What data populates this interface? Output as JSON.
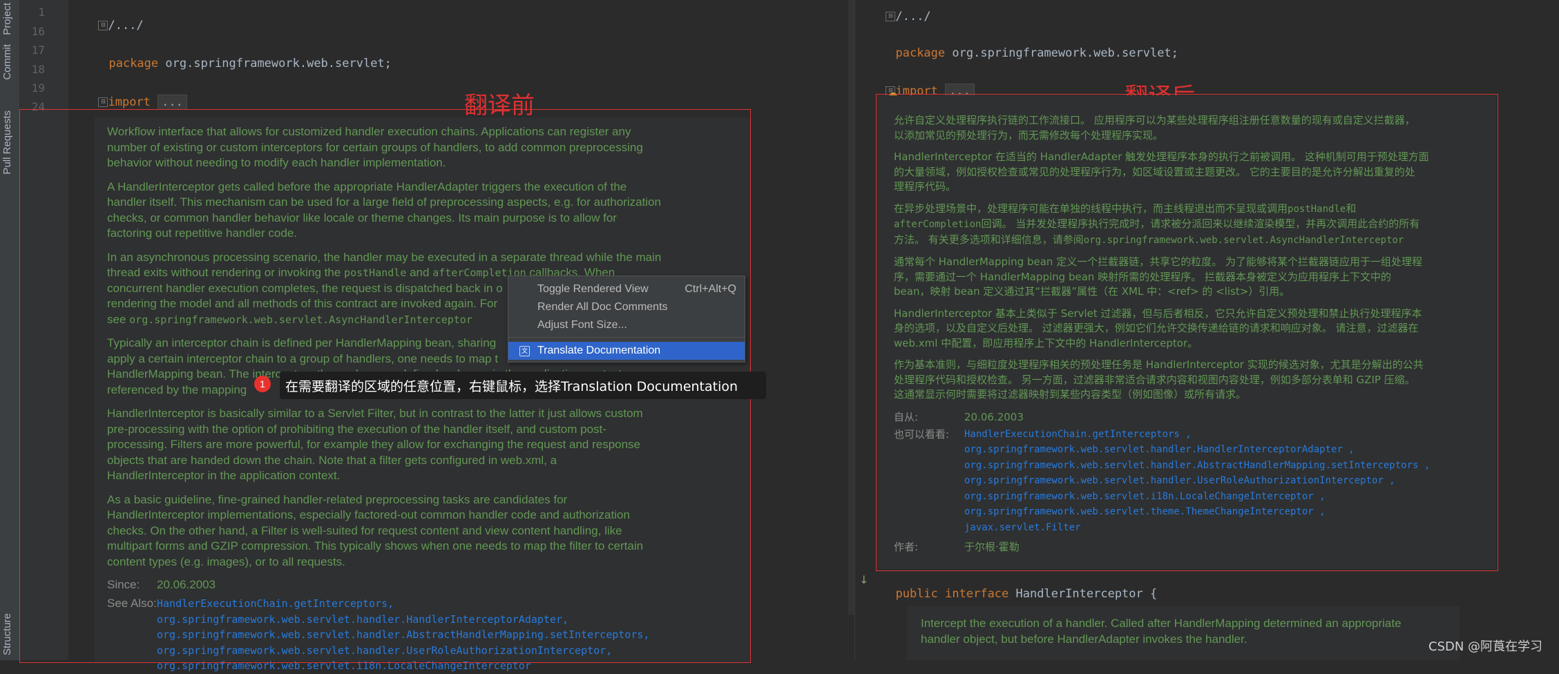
{
  "toolstrip": {
    "tabs": [
      "Project",
      "Commit",
      "Pull Requests",
      "Structure"
    ]
  },
  "left_editor": {
    "line_numbers": [
      "1",
      "16",
      "17",
      "18",
      "19",
      "24"
    ],
    "header_fold": "/.../",
    "package_kw": "package",
    "package_name": "org.springframework.web.servlet;",
    "import_kw": "import",
    "import_fold": "...",
    "title_before": "翻译前",
    "paragraphs": [
      "Workflow interface that allows for customized handler execution chains. Applications can register any\nnumber of existing or custom interceptors for certain groups of handlers, to add common preprocessing\nbehavior without needing to modify each handler implementation.",
      "A HandlerInterceptor gets called before the appropriate HandlerAdapter triggers the execution of the\nhandler itself. This mechanism can be used for a large field of preprocessing aspects, e.g. for authorization\nchecks, or common handler behavior like locale or theme changes. Its main purpose is to allow for\nfactoring out repetitive handler code."
    ],
    "para3_lines": [
      "In an asynchronous processing scenario, the handler may be executed in a separate thread while the main",
      "thread exits without rendering or invoking the",
      "postHandle",
      "and",
      "afterCompletion",
      "callbacks. When",
      "concurrent handler execution completes, the request is dispatched back in o",
      "rendering the model and all methods of this contract are invoked again. For",
      "see",
      "org.springframework.web.servlet.AsyncHandlerInterceptor"
    ],
    "para4_lines": [
      "Typically an interceptor chain is defined per HandlerMapping bean, sharing",
      "apply a certain interceptor chain to a group of handlers, one needs to map t",
      "HandlerMapping bean. The interceptors themselves are defined as beans in the application context,",
      "referenced by the mapping"
    ],
    "paragraphs_tail": [
      "HandlerInterceptor is basically similar to a Servlet Filter, but in contrast to the latter it just allows custom\npre-processing with the option of prohibiting the execution of the handler itself, and custom post-\nprocessing. Filters are more powerful, for example they allow for exchanging the request and response\nobjects that are handed down the chain. Note that a filter gets configured in web.xml, a\nHandlerInterceptor in the application context.",
      "As a basic guideline, fine-grained handler-related preprocessing tasks are candidates for\nHandlerInterceptor implementations, especially factored-out common handler code and authorization\nchecks. On the other hand, a Filter is well-suited for request content and view content handling, like\nmultipart forms and GZIP compression. This typically shows when one needs to map the filter to certain\ncontent types (e.g. images), or to all requests."
    ],
    "since_label": "Since:",
    "since_value": "20.06.2003",
    "see_also_label": "See Also:",
    "see_also": [
      "HandlerExecutionChain.getInterceptors,",
      "org.springframework.web.servlet.handler.HandlerInterceptorAdapter,",
      "org.springframework.web.servlet.handler.AbstractHandlerMapping.setInterceptors,",
      "org.springframework.web.servlet.handler.UserRoleAuthorizationInterceptor,",
      "org.springframework.web.servlet.i18n.LocaleChangeInterceptor"
    ]
  },
  "context_menu": {
    "items": [
      {
        "label": "Toggle Rendered View",
        "shortcut": "Ctrl+Alt+Q"
      },
      {
        "label": "Render All Doc Comments",
        "shortcut": ""
      },
      {
        "label": "Adjust Font Size...",
        "shortcut": ""
      },
      {
        "label": "Translate Documentation",
        "shortcut": ""
      }
    ]
  },
  "tooltip": {
    "badge": "1",
    "text": "在需要翻译的区域的任意位置，右键鼠标，选择Translation Documentation"
  },
  "right_editor": {
    "header_fold": "/.../",
    "package_kw": "package",
    "package_name": "org.springframework.web.servlet;",
    "import_kw": "import",
    "import_fold": "...",
    "title_after": "翻译后",
    "paragraphs": [
      "允许自定义处理程序执行链的工作流接口。 应用程序可以为某些处理程序组注册任意数量的现有或自定义拦截器，\n以添加常见的预处理行为，而无需修改每个处理程序实现。",
      "HandlerInterceptor 在适当的 HandlerAdapter 触发处理程序本身的执行之前被调用。 这种机制可用于预处理方面\n的大量领域，例如授权检查或常见的处理程序行为，如区域设置或主题更改。 它的主要目的是允许分解出重复的处\n理程序代码。"
    ],
    "para3_lines": [
      "在异步处理场景中，处理程序可能在单独的线程中执行，而主线程退出而不呈现或调用",
      "postHandle",
      "和",
      "afterCompletion",
      "回调。 当并发处理程序执行完成时，请求被分派回来以继续渲染模型，并再次调用此合约的所有",
      "方法。 有关更多选项和详细信息，请参阅",
      "org.springframework.web.servlet.AsyncHandlerInterceptor"
    ],
    "paragraphs_tail": [
      "通常每个 HandlerMapping bean 定义一个拦截器链，共享它的粒度。 为了能够将某个拦截器链应用于一组处理程\n序，需要通过一个 HandlerMapping bean 映射所需的处理程序。 拦截器本身被定义为应用程序上下文中的\nbean，映射 bean 定义通过其“拦截器”属性（在 XML 中：<ref> 的 <list>）引用。",
      "HandlerInterceptor 基本上类似于 Servlet 过滤器，但与后者相反，它只允许自定义预处理和禁止执行处理程序本\n身的选项，以及自定义后处理。 过滤器更强大，例如它们允许交换传递给链的请求和响应对象。 请注意，过滤器在\nweb.xml 中配置，即应用程序上下文中的 HandlerInterceptor。",
      "作为基本准则，与细粒度处理程序相关的预处理任务是 HandlerInterceptor 实现的候选对象，尤其是分解出的公共\n处理程序代码和授权检查。 另一方面，过滤器非常适合请求内容和视图内容处理，例如多部分表单和 GZIP 压缩。\n这通常显示何时需要将过滤器映射到某些内容类型（例如图像）或所有请求。"
    ],
    "since_label": "自从:",
    "since_value": "20.06.2003",
    "see_also_label": "也可以看看:",
    "see_also": [
      "HandlerExecutionChain.getInterceptors ,",
      "org.springframework.web.servlet.handler.HandlerInterceptorAdapter ,",
      "org.springframework.web.servlet.handler.AbstractHandlerMapping.setInterceptors ,",
      "org.springframework.web.servlet.handler.UserRoleAuthorizationInterceptor ,",
      "org.springframework.web.servlet.i18n.LocaleChangeInterceptor ,",
      "org.springframework.web.servlet.theme.ThemeChangeInterceptor ,",
      "javax.servlet.Filter"
    ],
    "author_label": "作者:",
    "author_value": "于尔根·霍勒",
    "interface_kw1": "public",
    "interface_kw2": "interface",
    "interface_name": "HandlerInterceptor {",
    "bottom_doc": "Intercept the execution of a handler. Called after HandlerMapping determined an appropriate\nhandler object, but before HandlerAdapter invokes the handler."
  },
  "watermark": "CSDN @阿莨在学习",
  "colors": {
    "red_annotation": "#e03030",
    "doc_green": "#629755",
    "keyword_orange": "#cc7832",
    "link_blue": "#287bde",
    "menu_selected": "#2f65ca"
  }
}
